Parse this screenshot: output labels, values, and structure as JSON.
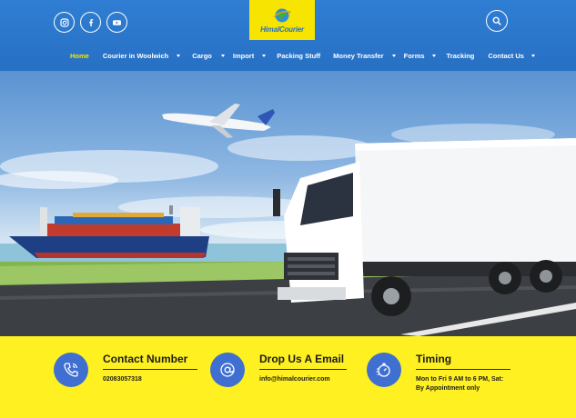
{
  "header": {
    "logo_text": "HimalCourier",
    "social": [
      "instagram-icon",
      "facebook-icon",
      "youtube-icon"
    ],
    "colors": {
      "header_blue": "#2b75c8",
      "accent_yellow": "#f7e400"
    }
  },
  "nav": {
    "items": [
      {
        "label": "Home",
        "active": true,
        "dropdown": false
      },
      {
        "label": "Courier in Woolwich",
        "active": false,
        "dropdown": true
      },
      {
        "label": "Cargo",
        "active": false,
        "dropdown": true
      },
      {
        "label": "Import",
        "active": false,
        "dropdown": true
      },
      {
        "label": "Packing Stuff",
        "active": false,
        "dropdown": false
      },
      {
        "label": "Money Transfer",
        "active": false,
        "dropdown": true
      },
      {
        "label": "Forms",
        "active": false,
        "dropdown": true
      },
      {
        "label": "Tracking",
        "active": false,
        "dropdown": false
      },
      {
        "label": "Contact Us",
        "active": false,
        "dropdown": true
      }
    ]
  },
  "contact": {
    "phone": {
      "title": "Contact Number",
      "value": "02083057318",
      "icon": "phone-icon"
    },
    "email": {
      "title": "Drop Us A Email",
      "value": "info@himalcourier.com",
      "icon": "at-icon"
    },
    "timing": {
      "title": "Timing",
      "line1": "Mon to Fri 9 AM to 6 PM, Sat:",
      "line2": "By Appointment only",
      "icon": "stopwatch-icon"
    },
    "colors": {
      "bar_yellow": "#fff021",
      "icon_blue": "#3f6fd1"
    }
  }
}
